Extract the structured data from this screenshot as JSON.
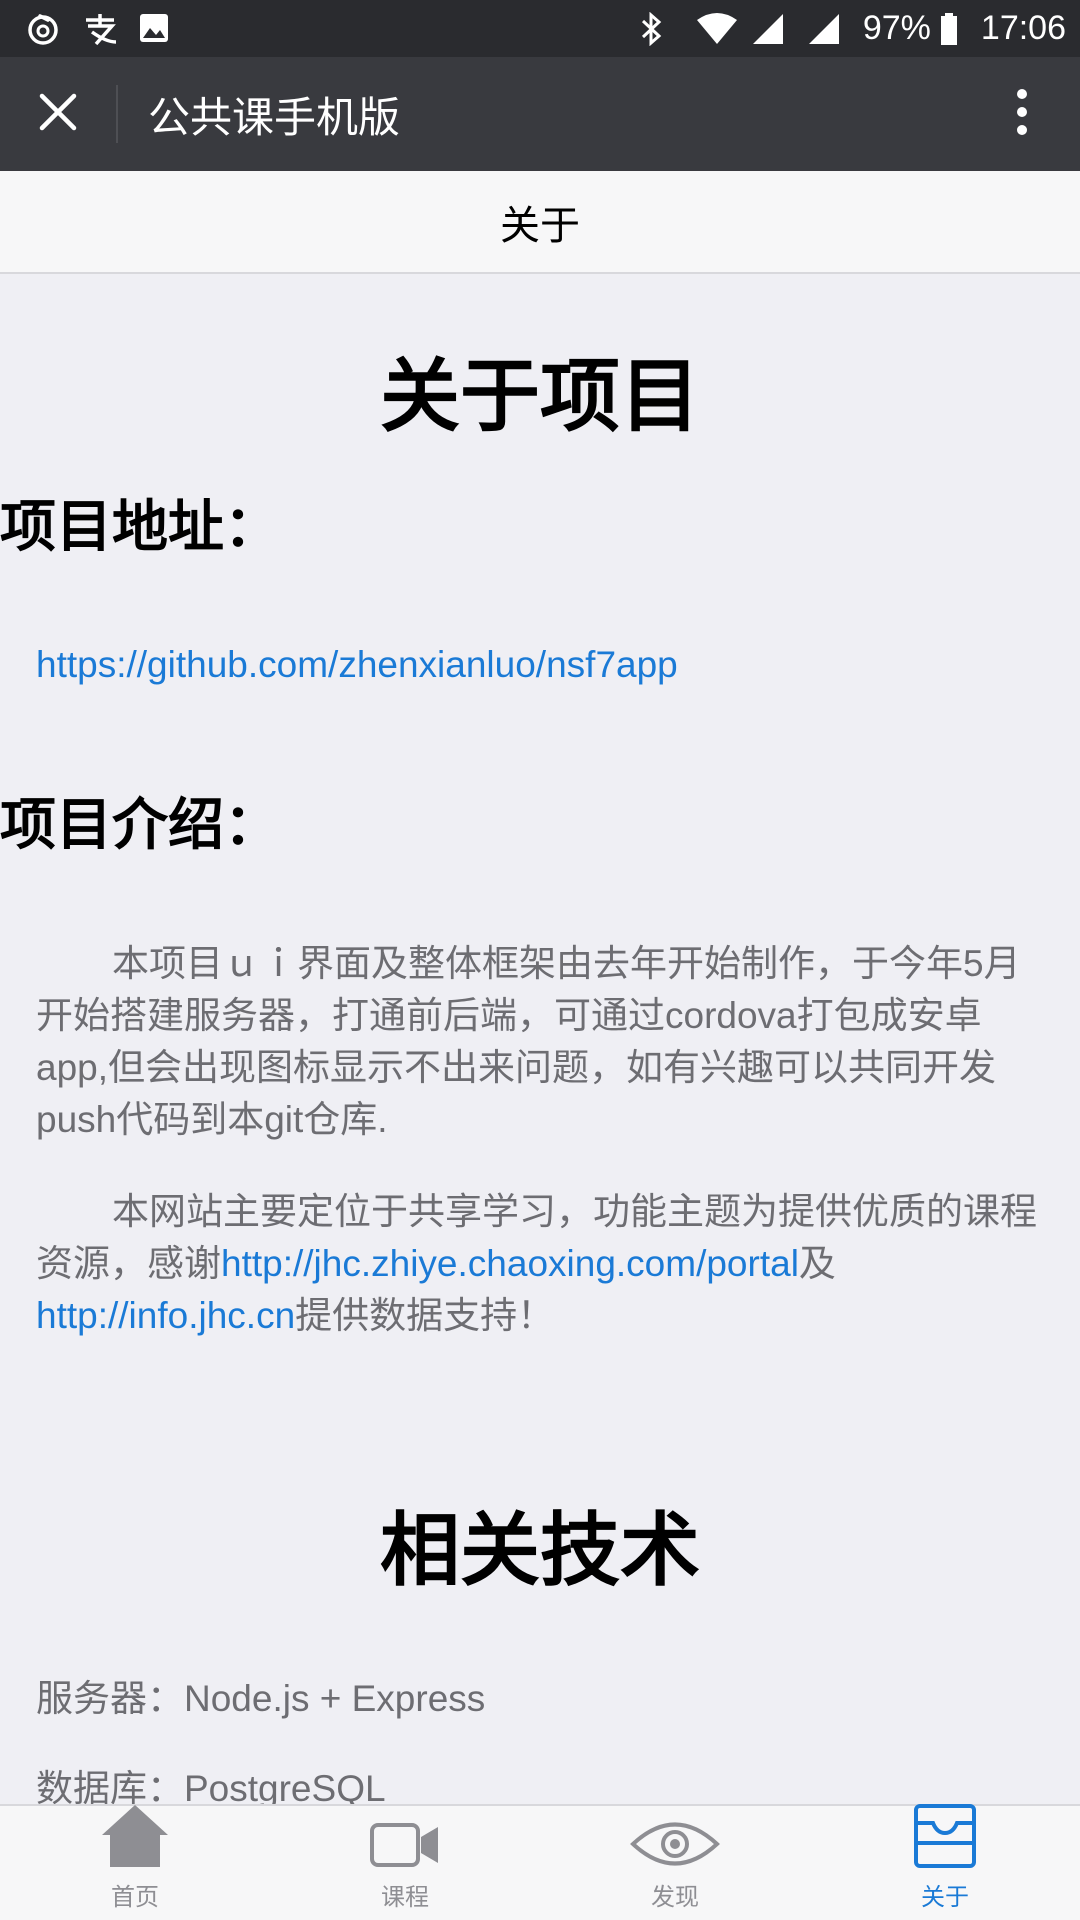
{
  "status_bar": {
    "battery": "97%",
    "time": "17:06",
    "icons": [
      "netease-music-icon",
      "alipay-icon",
      "image-icon",
      "bluetooth-icon",
      "wifi-icon",
      "signal-icon",
      "signal-icon",
      "battery-icon"
    ]
  },
  "title_bar": {
    "title": "公共课手机版"
  },
  "nav": {
    "title": "关于"
  },
  "main": {
    "heading1": "关于项目",
    "address_heading": "项目地址：",
    "address_link": "https://github.com/zhenxianluo/nsf7app",
    "intro_heading": "项目介绍：",
    "para1": "本项目ｕｉ界面及整体框架由去年开始制作，于今年5月开始搭建服务器，打通前后端，可通过cordova打包成安卓app,但会出现图标显示不出来问题，如有兴趣可以共同开发push代码到本git仓库.",
    "para2_pre": "本网站主要定位于共享学习，功能主题为提供优质的课程资源，感谢",
    "para2_link1": "http://jhc.zhiye.chaoxing.com/portal",
    "para2_mid": "及",
    "para2_link2": "http://info.jhc.cn",
    "para2_post": "提供数据支持！",
    "heading2": "相关技术",
    "tech_server": "服务器：Node.js + Express",
    "tech_db": "数据库：PostgreSQL"
  },
  "tabs": [
    {
      "label": "首页",
      "icon": "home-icon",
      "active": false
    },
    {
      "label": "课程",
      "icon": "video-camera-icon",
      "active": false
    },
    {
      "label": "发现",
      "icon": "eye-icon",
      "active": false
    },
    {
      "label": "关于",
      "icon": "inbox-icon",
      "active": true
    }
  ],
  "colors": {
    "accent": "#1a7ad6",
    "titlebar": "#393a3f",
    "statusbar": "#2a2b2f",
    "background": "#efeff4",
    "inactive_tab": "#8e8e93"
  }
}
